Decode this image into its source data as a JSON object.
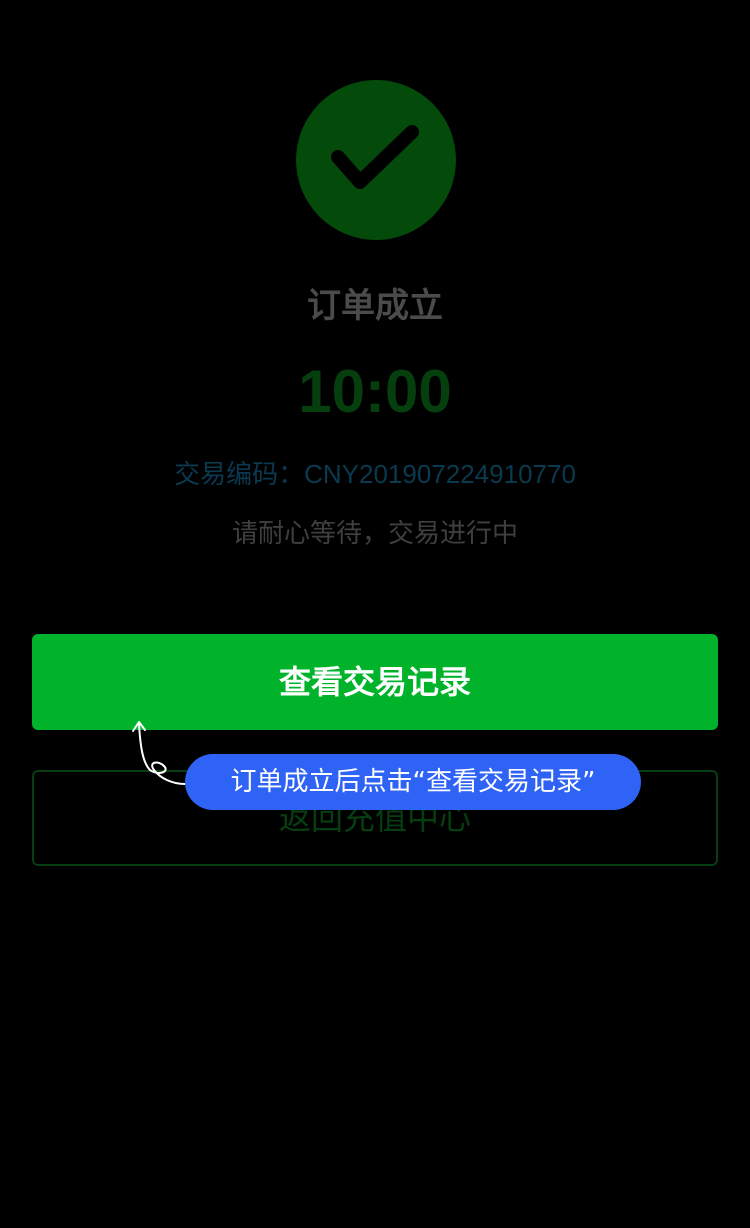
{
  "status": {
    "icon": "check-icon",
    "title": "订单成立",
    "countdown": "10:00"
  },
  "transaction": {
    "label": "交易编码：",
    "code": "CNY201907224910770"
  },
  "wait_message": "请耐心等待，交易进行中",
  "buttons": {
    "view_records": "查看交易记录",
    "back_to_recharge": "返回充值中心"
  },
  "hint": {
    "text": "订单成立后点击“查看交易记录”"
  },
  "colors": {
    "background": "#000000",
    "primary_green": "#00b32a",
    "hint_blue": "#2f63f5",
    "success_circle": "#034a0b"
  }
}
